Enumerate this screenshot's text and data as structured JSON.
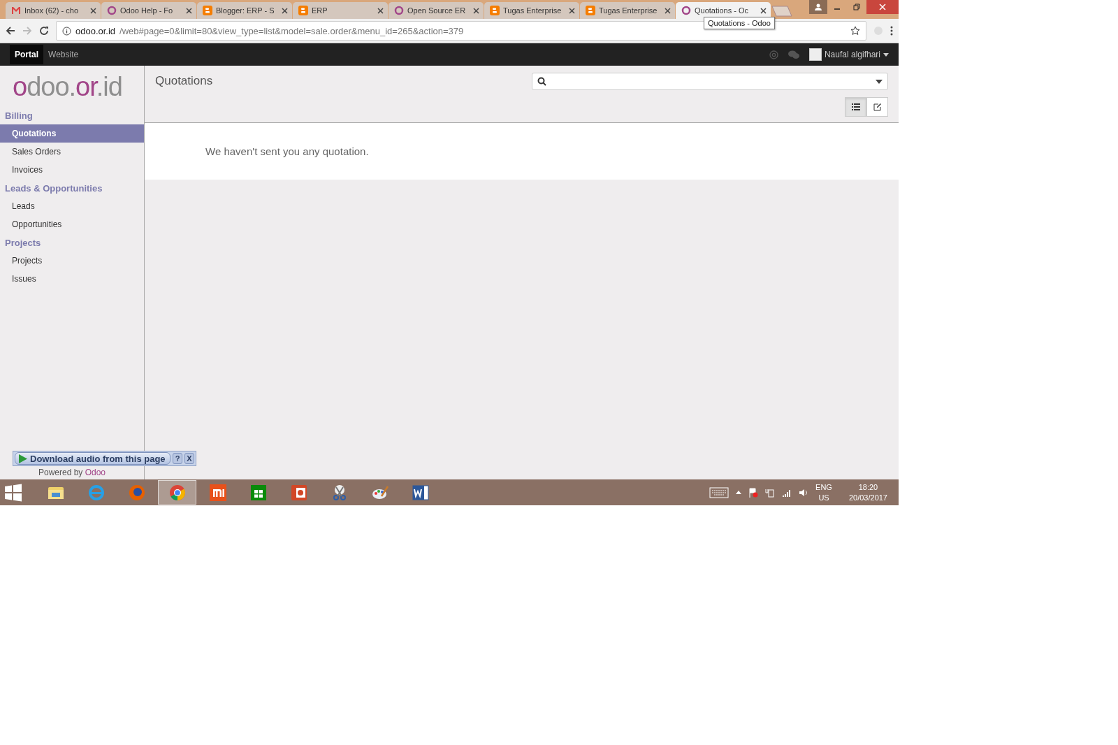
{
  "browser": {
    "tabs": [
      {
        "kind": "gmail",
        "title": "Inbox (62) - cho",
        "selected": false
      },
      {
        "kind": "odoo",
        "title": "Odoo Help - Fo",
        "selected": false
      },
      {
        "kind": "blogger",
        "title": "Blogger: ERP - S",
        "selected": false
      },
      {
        "kind": "blogger",
        "title": "ERP",
        "selected": false
      },
      {
        "kind": "odoo",
        "title": "Open Source ER",
        "selected": false
      },
      {
        "kind": "blogger",
        "title": "Tugas Enterprise",
        "selected": false
      },
      {
        "kind": "blogger",
        "title": "Tugas Enterprise",
        "selected": false
      },
      {
        "kind": "odoo",
        "title": "Quotations - Oc",
        "selected": true
      }
    ],
    "tooltip": "Quotations - Odoo",
    "url_host": "odoo.or.id",
    "url_path": "/web#page=0&limit=80&view_type=list&model=sale.order&menu_id=265&action=379"
  },
  "topbar": {
    "menus": [
      {
        "label": "Portal",
        "selected": true
      },
      {
        "label": "Website",
        "selected": false
      }
    ],
    "user": "Naufal algifhari"
  },
  "logo": [
    {
      "text": "o",
      "accent": true
    },
    {
      "text": "doo.",
      "accent": false
    },
    {
      "text": "or",
      "accent": true
    },
    {
      "text": ".id",
      "accent": false
    }
  ],
  "sidebar": {
    "sections": [
      {
        "title": "Billing",
        "items": [
          {
            "label": "Quotations",
            "selected": true
          },
          {
            "label": "Sales Orders",
            "selected": false
          },
          {
            "label": "Invoices",
            "selected": false
          }
        ]
      },
      {
        "title": "Leads & Opportunities",
        "items": [
          {
            "label": "Leads",
            "selected": false
          },
          {
            "label": "Opportunities",
            "selected": false
          }
        ]
      },
      {
        "title": "Projects",
        "items": [
          {
            "label": "Projects",
            "selected": false
          },
          {
            "label": "Issues",
            "selected": false
          }
        ]
      }
    ],
    "powered_by": "Powered by",
    "powered_brand": "Odoo"
  },
  "main": {
    "title": "Quotations",
    "views": [
      {
        "kind": "list",
        "selected": true
      },
      {
        "kind": "form",
        "selected": false
      }
    ],
    "empty_message": "We haven't sent you any quotation."
  },
  "audio_bar": {
    "label": "Download audio from this page",
    "help": "?",
    "close": "X"
  },
  "taskbar": {
    "apps": [
      {
        "kind": "explorer",
        "active": false
      },
      {
        "kind": "ie",
        "active": false
      },
      {
        "kind": "firefox",
        "active": false
      },
      {
        "kind": "chrome",
        "active": true
      },
      {
        "kind": "mi",
        "active": false
      },
      {
        "kind": "store",
        "active": false
      },
      {
        "kind": "powerpoint",
        "active": false
      },
      {
        "kind": "snipping",
        "active": false
      },
      {
        "kind": "paint",
        "active": false
      },
      {
        "kind": "word",
        "active": false
      }
    ],
    "lang": "ENG",
    "region": "US",
    "time": "18:20",
    "date": "20/03/2017"
  }
}
